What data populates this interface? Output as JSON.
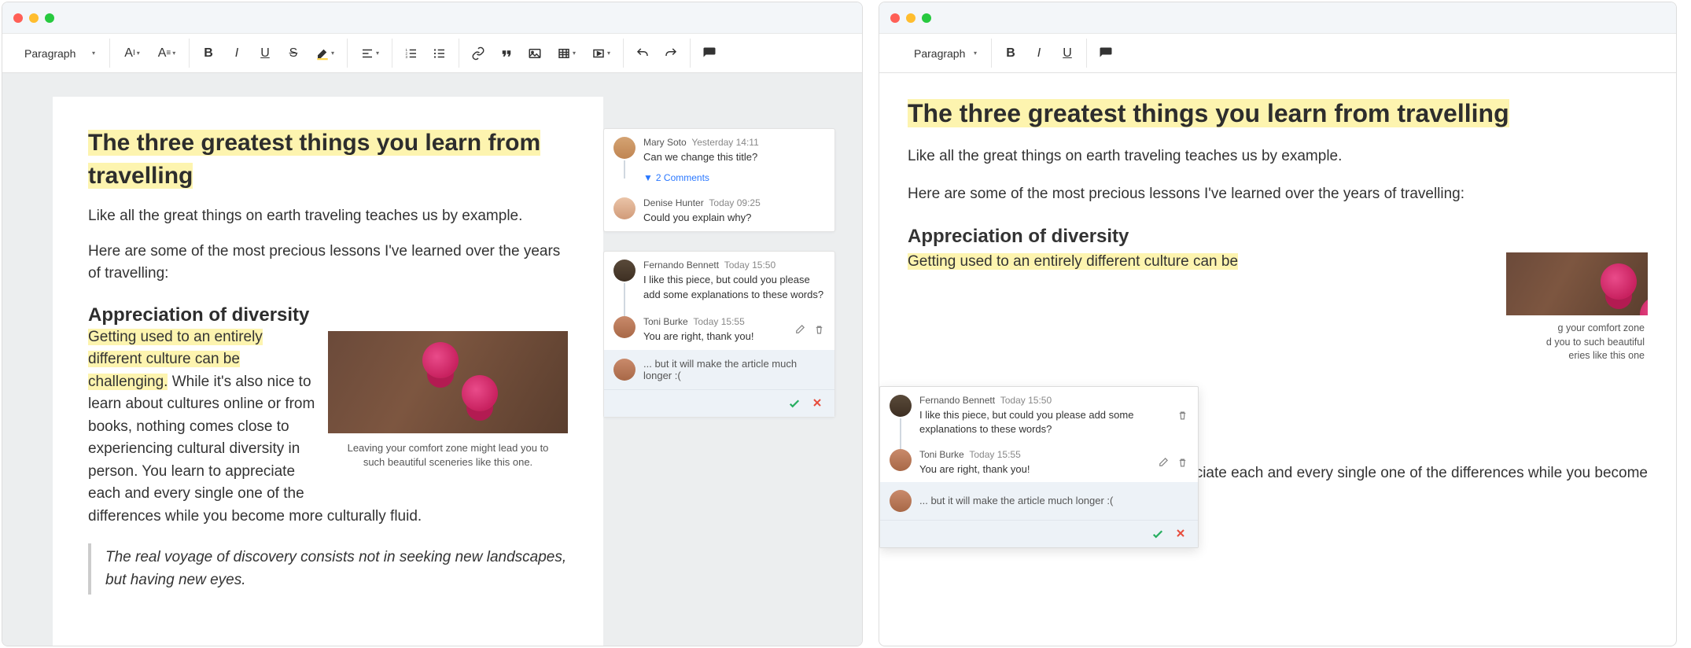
{
  "toolbar": {
    "paragraph_label": "Paragraph"
  },
  "doc": {
    "title": "The three greatest things you learn from travelling",
    "intro": "Like all the great things on earth traveling teaches us by example.",
    "lead": "Here are some of the most precious lessons I've learned over the years of travelling:",
    "h2": "Appreciation of diversity",
    "hl_sentence": "Getting used to an entirely different culture can be challenging.",
    "body_rest": " While it's also nice to learn about cultures online or from books, nothing comes close to experiencing cultural diversity in person. You learn to appreciate each and every single one of the differences while you become more culturally fluid.",
    "caption": "Leaving your comfort zone might lead you to such beautiful sceneries like this one.",
    "quote": "The real voyage of discovery consists not in seeking new landscapes, but having new eyes."
  },
  "doc2": {
    "hl_sentence_partial": "Getting used to an entirely different culture can be",
    "body_rest2": "ciate each and every single one of the differences while you become",
    "caption2a": "g your comfort zone",
    "caption2b": "d you to such beautiful",
    "caption2c": "eries like this one"
  },
  "comments": {
    "thread1": {
      "c1": {
        "author": "Mary Soto",
        "time": "Yesterday 14:11",
        "text": "Can we change this title?"
      },
      "replies_label": "2 Comments",
      "c2": {
        "author": "Denise Hunter",
        "time": "Today 09:25",
        "text": "Could you explain why?"
      }
    },
    "thread2": {
      "c1": {
        "author": "Fernando Bennett",
        "time": "Today 15:50",
        "text": "I like this piece, but could you please add some explanations to these words?"
      },
      "c2": {
        "author": "Toni Burke",
        "time": "Today 15:55",
        "text": "You are right, thank you!"
      },
      "reply_draft": "... but it will make the article much longer :("
    }
  }
}
